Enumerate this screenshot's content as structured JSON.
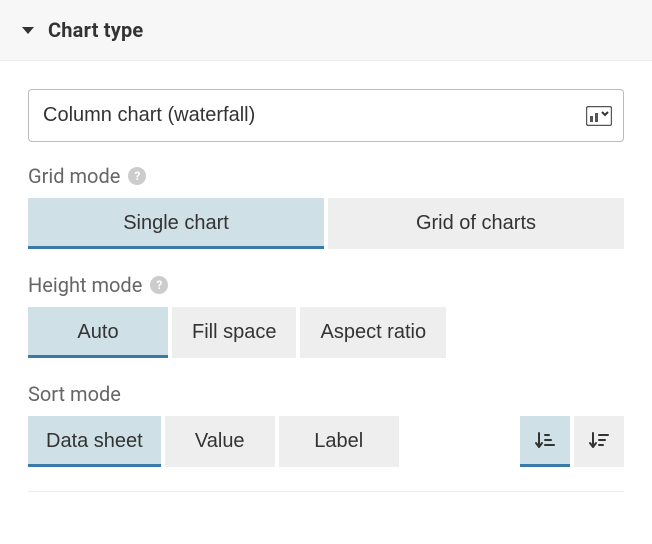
{
  "section": {
    "title": "Chart type"
  },
  "chart_select": {
    "value": "Column chart (waterfall)"
  },
  "grid_mode": {
    "label": "Grid mode",
    "options": [
      "Single chart",
      "Grid of charts"
    ],
    "selected": "Single chart"
  },
  "height_mode": {
    "label": "Height mode",
    "options": [
      "Auto",
      "Fill space",
      "Aspect ratio"
    ],
    "selected": "Auto"
  },
  "sort_mode": {
    "label": "Sort mode",
    "options": [
      "Data sheet",
      "Value",
      "Label"
    ],
    "selected": "Data sheet",
    "direction": "asc"
  }
}
